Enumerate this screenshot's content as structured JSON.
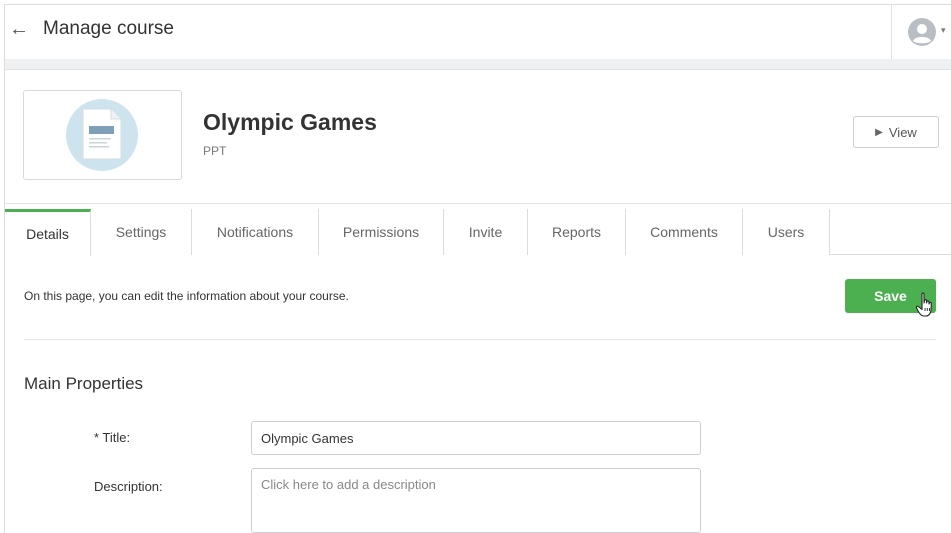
{
  "header": {
    "back_label": "←",
    "title": "Manage course",
    "account_caret": "▾",
    "avatar_icon": "user-avatar-icon"
  },
  "course": {
    "name": "Olympic Games",
    "type": "PPT",
    "thumbnail_icon": "document-icon",
    "view_label": "View"
  },
  "tabs": [
    {
      "label": "Details",
      "active": true
    },
    {
      "label": "Settings"
    },
    {
      "label": "Notifications"
    },
    {
      "label": "Permissions"
    },
    {
      "label": "Invite"
    },
    {
      "label": "Reports"
    },
    {
      "label": "Comments"
    },
    {
      "label": "Users"
    }
  ],
  "details": {
    "intro": "On this page, you can edit the information about your course.",
    "save_label": "Save",
    "section_title": "Main Properties",
    "title_label": "* Title:",
    "title_value": "Olympic Games",
    "description_label": "Description:",
    "description_placeholder": "Click here to add a description"
  },
  "colors": {
    "accent": "#4caf50",
    "thumb_bg": "#cde4ef"
  }
}
